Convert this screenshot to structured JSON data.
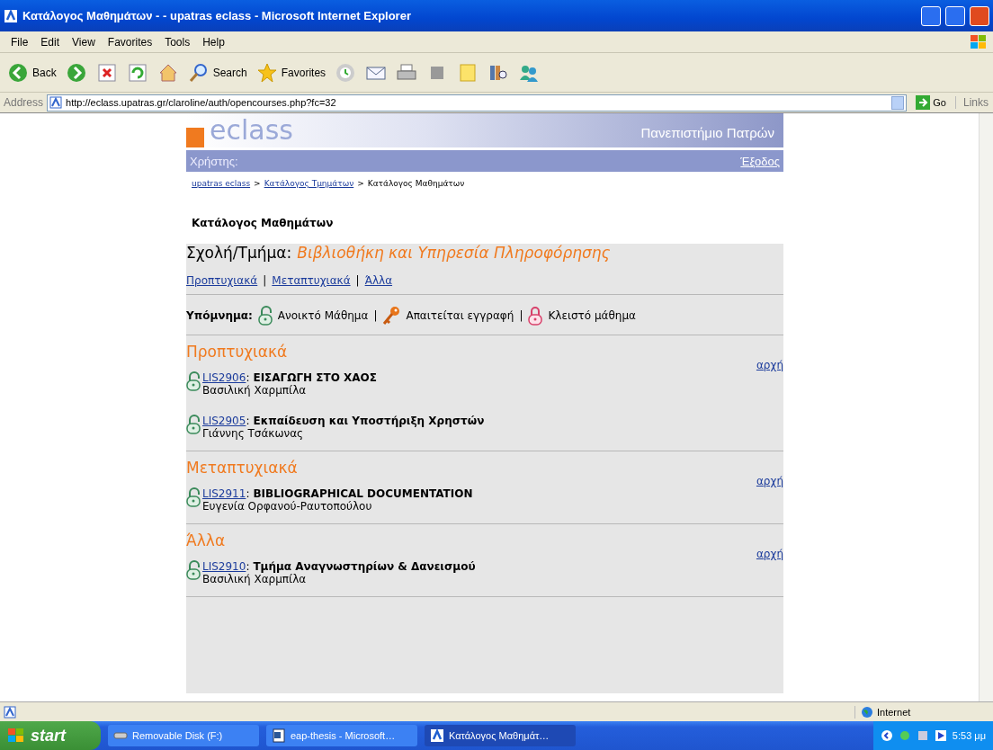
{
  "window": {
    "title": "Κατάλογος Μαθημάτων - - upatras eclass - Microsoft Internet Explorer"
  },
  "menu": [
    "File",
    "Edit",
    "View",
    "Favorites",
    "Tools",
    "Help"
  ],
  "toolbar": [
    {
      "kind": "back",
      "label": "Back"
    },
    {
      "kind": "forward"
    },
    {
      "kind": "stop"
    },
    {
      "kind": "refresh"
    },
    {
      "kind": "home"
    },
    {
      "kind": "search",
      "label": "Search"
    },
    {
      "kind": "favorites",
      "label": "Favorites"
    },
    {
      "kind": "history"
    },
    {
      "kind": "mail"
    },
    {
      "kind": "print"
    },
    {
      "kind": "edit"
    },
    {
      "kind": "note"
    },
    {
      "kind": "research"
    },
    {
      "kind": "messenger"
    }
  ],
  "address": {
    "label": "Address",
    "value": "http://eclass.upatras.gr/claroline/auth/opencourses.php?fc=32",
    "go": "Go",
    "links": "Links"
  },
  "page": {
    "logo_text": "eclass",
    "university": "Πανεπιστήμιο Πατρών",
    "user_label": "Χρήστης:",
    "logout": "Έξοδος",
    "breadcrumb": [
      {
        "text": "upatras eclass",
        "link": true
      },
      {
        "separator": ">",
        "text": "Κατάλογος Τμημάτων",
        "link": true
      },
      {
        "separator": ">",
        "text": "Κατάλογος Μαθημάτων",
        "link": false
      }
    ],
    "heading": "Κατάλογος Μαθημάτων",
    "department_label": "Σχολή/Τμήμα:",
    "department": "Βιβλιοθήκη και Υπηρεσία Πληροφόρησης",
    "level_links": [
      {
        "text": "Προπτυχιακά"
      },
      {
        "separator": "|",
        "text": "Μεταπτυχιακά"
      },
      {
        "separator": "|",
        "text": "Άλλα"
      }
    ],
    "legend_label": "Υπόμνημα:",
    "legend": [
      {
        "kind": "open",
        "text": "Ανοικτό Μάθημα"
      },
      {
        "separator": "|",
        "kind": "key",
        "text": "Απαιτείται εγγραφή"
      },
      {
        "separator": "|",
        "kind": "closed",
        "text": "Κλειστό μάθημα"
      }
    ],
    "sections": [
      {
        "title": "Προπτυχιακά",
        "top_link": "αρχή",
        "courses": [
          {
            "kind": "open",
            "code": "LIS2906",
            "code_suffix": ":",
            "title": "ΕΙΣΑΓΩΓΗ ΣΤΟ ΧΑΟΣ",
            "teacher": "Βασιλική Χαρμπίλα"
          },
          {
            "kind": "open",
            "code": "LIS2905",
            "code_suffix": ":",
            "title": "Εκπαίδευση και Υποστήριξη Χρηστών",
            "teacher": "Γιάννης Τσάκωνας"
          }
        ]
      },
      {
        "title": "Μεταπτυχιακά",
        "top_link": "αρχή",
        "courses": [
          {
            "kind": "open",
            "code": "LIS2911",
            "code_suffix": ":",
            "title": "BIBLIOGRAPHICAL DOCUMENTATION",
            "teacher": "Ευγενία Ορφανού-Ραυτοπούλου"
          }
        ]
      },
      {
        "title": "Άλλα",
        "top_link": "αρχή",
        "courses": [
          {
            "kind": "open",
            "code": "LIS2910",
            "code_suffix": ":",
            "title": "Τμήμα Αναγνωστηρίων & Δανεισμού",
            "teacher": "Βασιλική Χαρμπίλα"
          }
        ]
      }
    ]
  },
  "status_bar": {
    "zone": "Internet"
  },
  "taskbar": {
    "start": "start",
    "tasks": [
      {
        "kind": "disk",
        "label": "Removable Disk (F:)",
        "selected": false
      },
      {
        "kind": "word",
        "label": "eap-thesis - Microsoft…",
        "selected": false
      },
      {
        "kind": "ie",
        "label": "Κατάλογος Μαθημάτ…",
        "selected": true
      }
    ],
    "clock": "5:53 μμ"
  }
}
